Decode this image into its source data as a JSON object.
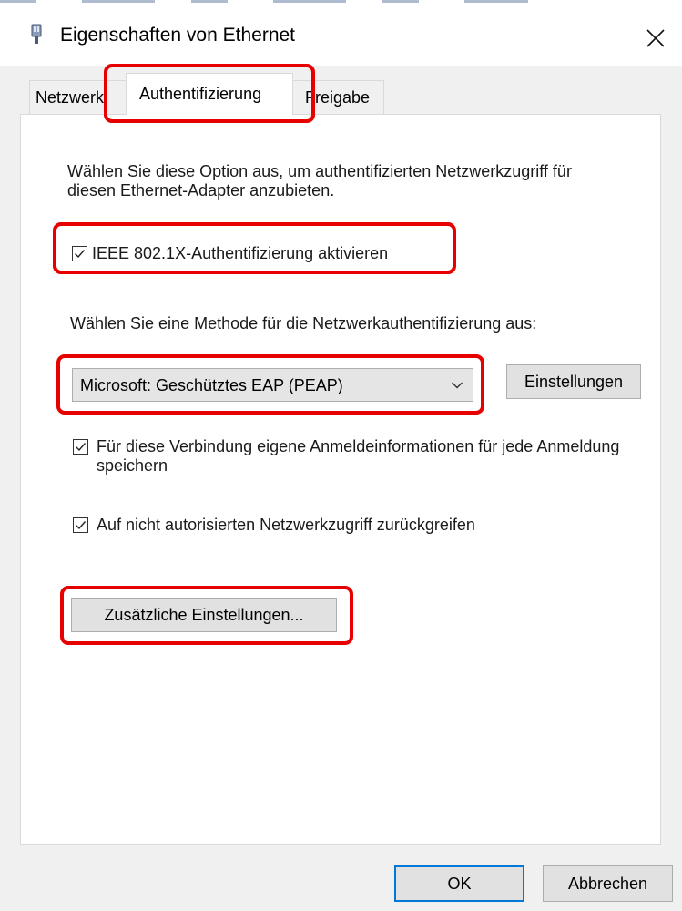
{
  "window": {
    "title": "Eigenschaften von Ethernet",
    "close_icon": "close-icon",
    "app_icon": "network-adapter-icon"
  },
  "tabs": [
    {
      "label": "Netzwerk",
      "active": false
    },
    {
      "label": "Authentifizierung",
      "active": true
    },
    {
      "label": "Freigabe",
      "active": false
    }
  ],
  "authentication": {
    "description": "Wählen Sie diese Option aus, um authentifizierten Netzwerkzugriff für diesen Ethernet-Adapter anzubieten.",
    "enable_8021x": {
      "label": "IEEE 802.1X-Authentifizierung aktivieren",
      "checked": true
    },
    "method_prompt": "Wählen Sie eine Methode für die Netzwerkauthentifizierung aus:",
    "method_select": {
      "value": "Microsoft: Geschütztes EAP (PEAP)"
    },
    "settings_button": "Einstellungen",
    "remember_credentials": {
      "label": "Für diese Verbindung eigene Anmeldeinformationen für jede Anmeldung speichern",
      "checked": true
    },
    "fallback_unauthorized": {
      "label": "Auf nicht autorisierten Netzwerkzugriff zurückgreifen",
      "checked": true
    },
    "additional_settings_button": "Zusätzliche Einstellungen..."
  },
  "footer": {
    "ok_label": "OK",
    "cancel_label": "Abbrechen"
  },
  "colors": {
    "highlight": "#e60000",
    "accent": "#0078d7",
    "button_bg": "#e1e1e1"
  }
}
